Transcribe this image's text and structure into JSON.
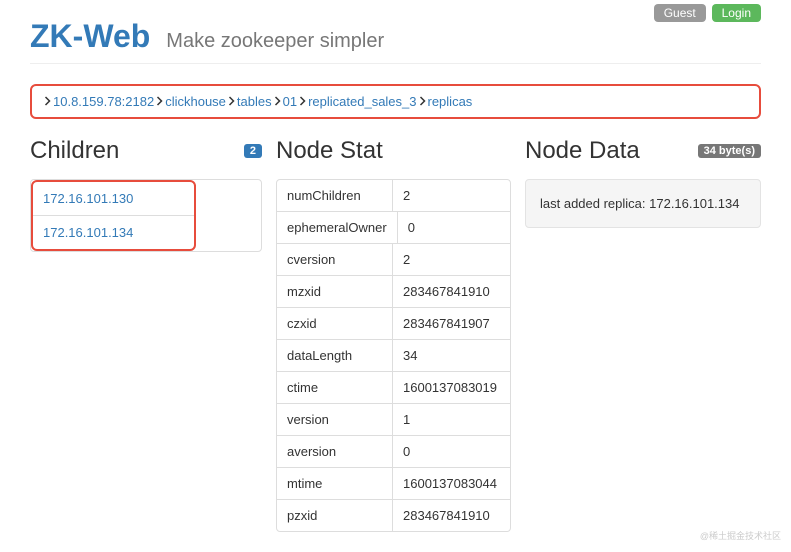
{
  "topbar": {
    "guest": "Guest",
    "login": "Login"
  },
  "header": {
    "brand": "ZK-Web",
    "tagline": "Make zookeeper simpler"
  },
  "breadcrumb": [
    "10.8.159.78:2182",
    "clickhouse",
    "tables",
    "01",
    "replicated_sales_3",
    "replicas"
  ],
  "children": {
    "title": "Children",
    "count": "2",
    "items": [
      "172.16.101.130",
      "172.16.101.134"
    ]
  },
  "nodeStat": {
    "title": "Node Stat",
    "rows": [
      {
        "k": "numChildren",
        "v": "2"
      },
      {
        "k": "ephemeralOwner",
        "v": "0"
      },
      {
        "k": "cversion",
        "v": "2"
      },
      {
        "k": "mzxid",
        "v": "283467841910"
      },
      {
        "k": "czxid",
        "v": "283467841907"
      },
      {
        "k": "dataLength",
        "v": "34"
      },
      {
        "k": "ctime",
        "v": "1600137083019"
      },
      {
        "k": "version",
        "v": "1"
      },
      {
        "k": "aversion",
        "v": "0"
      },
      {
        "k": "mtime",
        "v": "1600137083044"
      },
      {
        "k": "pzxid",
        "v": "283467841910"
      }
    ]
  },
  "nodeData": {
    "title": "Node Data",
    "bytes": "34 byte(s)",
    "content": "last added replica: 172.16.101.134"
  },
  "watermark": "@稀土掘金技术社区"
}
